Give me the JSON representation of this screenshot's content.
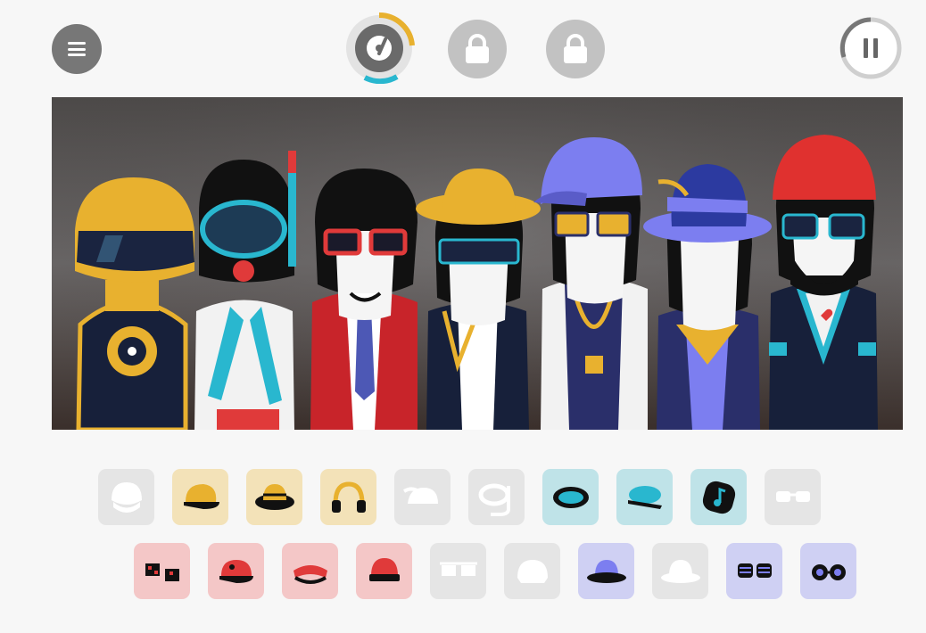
{
  "colors": {
    "background": "#f7f7f7",
    "menu_button": "#777777",
    "locked_button": "#c2c2c2",
    "timer_accent_yellow": "#e8b12f",
    "timer_accent_cyan": "#29b7cf",
    "stage_backdrop": "#5a5757",
    "category_yellow": "#f3e2b8",
    "category_cyan": "#bfe3e8",
    "category_red": "#f4c7c7",
    "category_blue": "#cfd0f3",
    "category_inactive": "#e5e5e5"
  },
  "top_bar": {
    "menu_icon": "hamburger-icon",
    "record_icon": "vinyl-record-icon",
    "locked_icons": [
      "lock-icon",
      "lock-icon"
    ],
    "pause_icon": "pause-icon"
  },
  "stage": {
    "characters": [
      {
        "id": "robot-helmet",
        "hat_color": "#e8b12f"
      },
      {
        "id": "snorkel-mask",
        "hat_color": "#29b7cf"
      },
      {
        "id": "red-glasses",
        "hat_color": "#e03a3a"
      },
      {
        "id": "straw-hat",
        "hat_color": "#e8b12f"
      },
      {
        "id": "blue-cap",
        "hat_color": "#7c7ef0"
      },
      {
        "id": "blue-fedora",
        "hat_color": "#3f4bb8"
      },
      {
        "id": "red-beanie",
        "hat_color": "#e0312f"
      }
    ]
  },
  "palette": {
    "row1": [
      {
        "icon": "helmet-icon",
        "category": "inactive"
      },
      {
        "icon": "cap-icon",
        "category": "yellow"
      },
      {
        "icon": "straw-hat-icon",
        "category": "yellow"
      },
      {
        "icon": "headphones-icon",
        "category": "yellow"
      },
      {
        "icon": "feather-hat-icon",
        "category": "inactive"
      },
      {
        "icon": "snorkel-icon",
        "category": "inactive"
      },
      {
        "icon": "diving-mask-icon",
        "category": "cyan"
      },
      {
        "icon": "beret-icon",
        "category": "cyan"
      },
      {
        "icon": "music-note-bubble-icon",
        "category": "cyan"
      },
      {
        "icon": "sunglasses-icon",
        "category": "inactive"
      }
    ],
    "row2": [
      {
        "icon": "pixel-glasses-icon",
        "category": "red"
      },
      {
        "icon": "cap-icon",
        "category": "red"
      },
      {
        "icon": "visor-icon",
        "category": "red"
      },
      {
        "icon": "beanie-icon",
        "category": "red"
      },
      {
        "icon": "3d-glasses-icon",
        "category": "inactive"
      },
      {
        "icon": "helmet-icon",
        "category": "inactive"
      },
      {
        "icon": "fedora-icon",
        "category": "blue"
      },
      {
        "icon": "fedora-icon",
        "category": "inactive"
      },
      {
        "icon": "shutter-shades-icon",
        "category": "blue"
      },
      {
        "icon": "round-glasses-icon",
        "category": "blue"
      }
    ]
  }
}
